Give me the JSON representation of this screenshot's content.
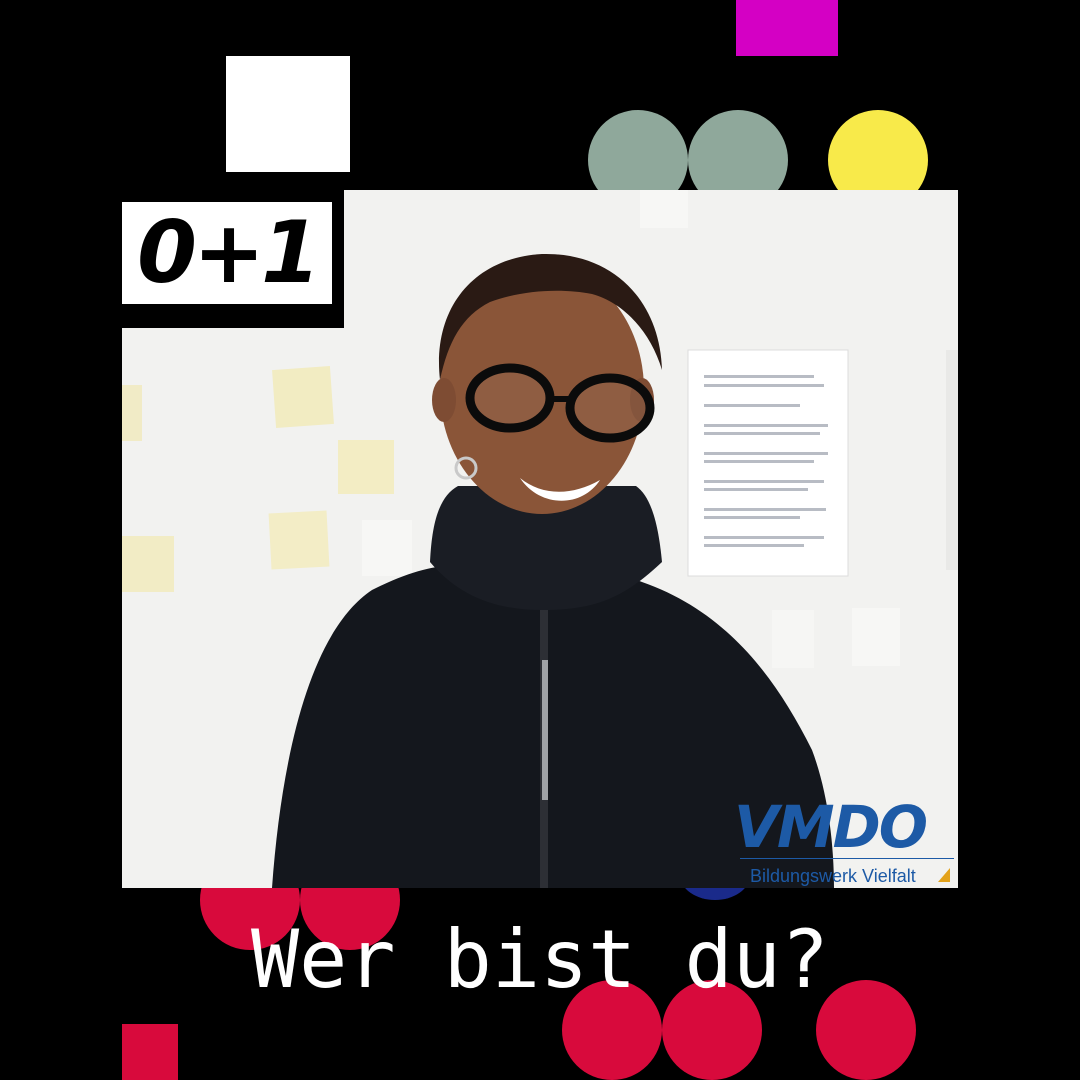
{
  "badge": {
    "text": "0+1"
  },
  "logo": {
    "brand": "VMDO",
    "subtitle": "Bildungswerk Vielfalt"
  },
  "caption": "Wer bist du?",
  "colors": {
    "background": "#000000",
    "magenta": "#d400c4",
    "sage": "#8fa89b",
    "yellow": "#f8ea4a",
    "red": "#d80a3c",
    "navy": "#1a2a8a",
    "brand_blue": "#1d5aa6",
    "brand_orange": "#e3a21a"
  },
  "photo": {
    "subject": "smiling woman with black glasses and black zip turtleneck in front of white wall with sticky notes"
  }
}
